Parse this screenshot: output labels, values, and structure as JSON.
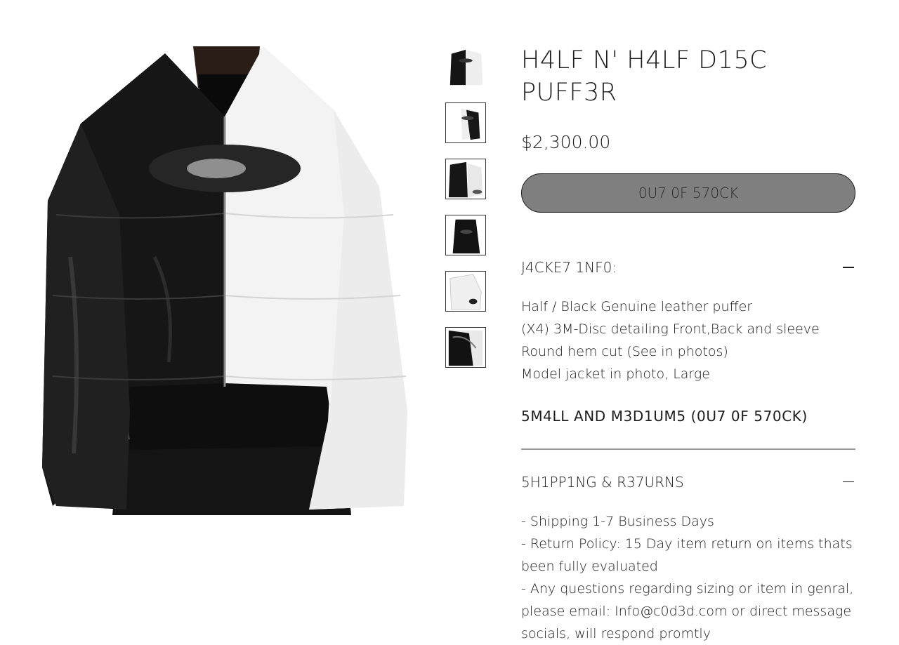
{
  "product": {
    "title": "H4LF N' H4LF D15C PUFF3R",
    "price": "$2,300.00",
    "stock_button": "0U7 0F 570CK"
  },
  "jacket_info": {
    "heading": "J4CKE7 1NF0:",
    "lines": [
      "Half / Black Genuine leather puffer",
      "(X4) 3M-Disc detailing Front,Back and sleeve",
      "Round hem cut (See in photos)",
      "Model jacket in photo, Large"
    ],
    "sizes_note": "5M4LL AND M3D1UM5 (0U7 0F 570CK)"
  },
  "shipping": {
    "heading": "5H1PP1NG & R37URNS",
    "lines": [
      "- Shipping 1-7 Business Days",
      "- Return Policy: 15 Day item return on items thats been fully evaluated",
      "- Any questions regarding sizing or item in genral, please email: Info@c0d3d.com or direct message socials, will respond promtly"
    ]
  },
  "colors": {
    "button_fill": "#7f7f7f",
    "text": "#1c1c1c",
    "divider": "#9a9a9a"
  },
  "icons": {
    "collapse": "minus-icon"
  }
}
